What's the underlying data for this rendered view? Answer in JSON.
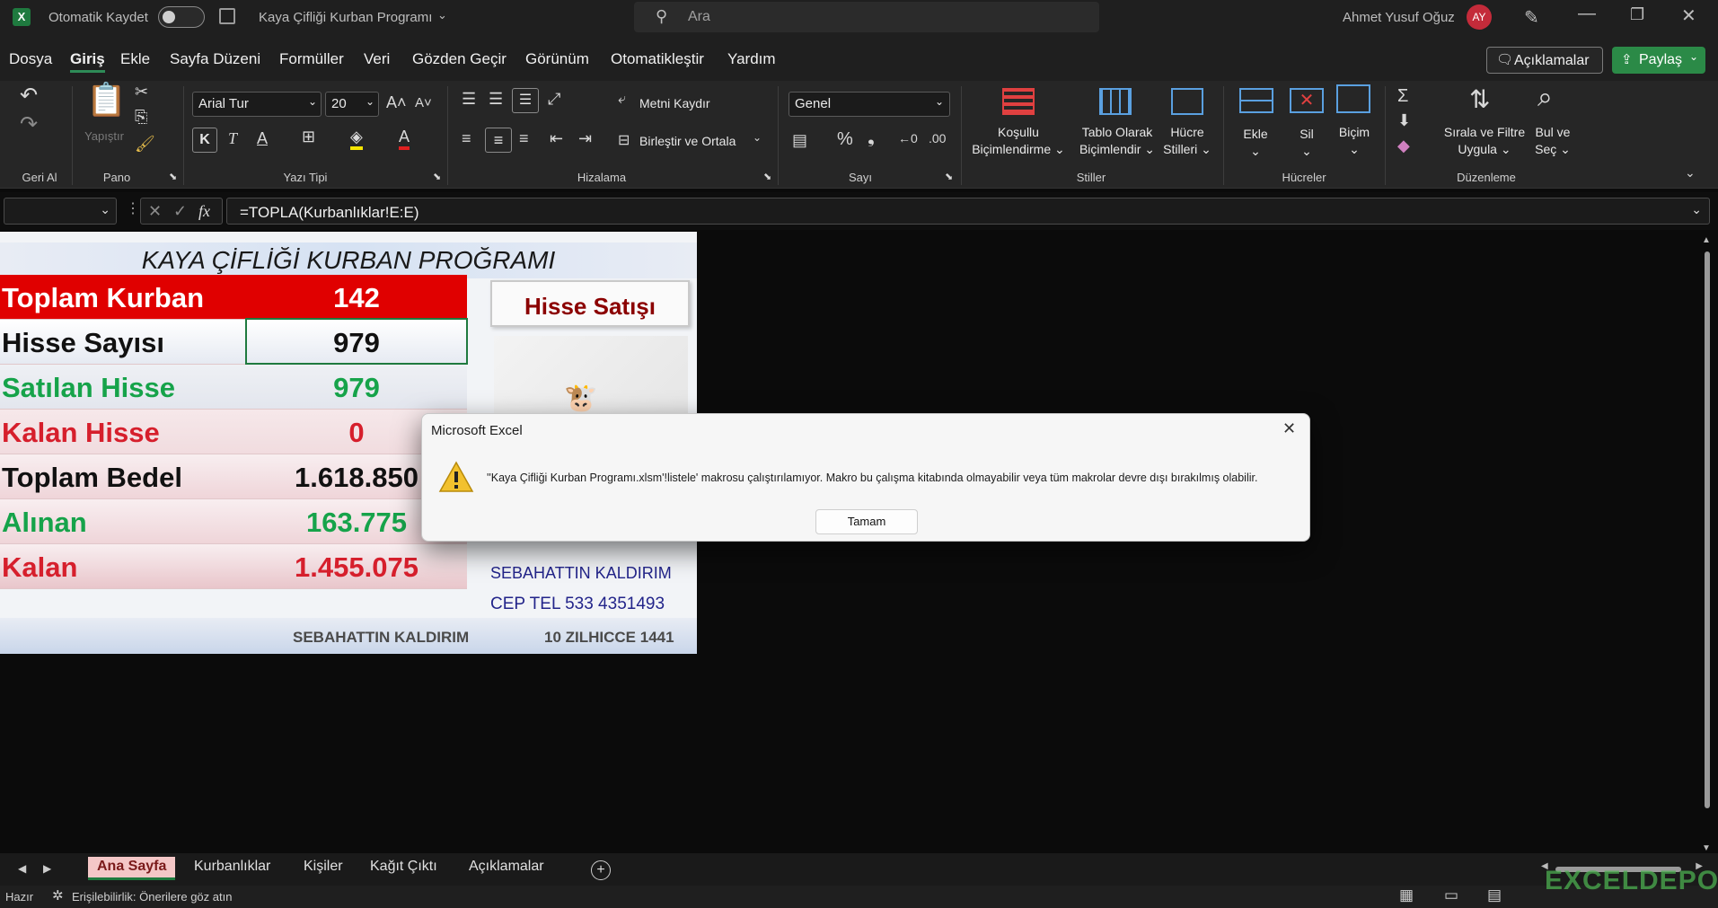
{
  "titlebar": {
    "autosave_label": "Otomatik Kaydet",
    "doc_title": "Kaya Çifliği Kurban Programı",
    "search_placeholder": "Ara",
    "user_name": "Ahmet Yusuf Oğuz",
    "user_initials": "AY"
  },
  "menu": [
    "Dosya",
    "Giriş",
    "Ekle",
    "Sayfa Düzeni",
    "Formüller",
    "Veri",
    "Gözden Geçir",
    "Görünüm",
    "Otomatikleştir",
    "Yardım"
  ],
  "menu_active": "Giriş",
  "actions": {
    "comments": "Açıklamalar",
    "share": "Paylaş"
  },
  "ribbon": {
    "groups": {
      "undo": "Geri Al",
      "clipboard": "Pano",
      "font": "Yazı Tipi",
      "alignment": "Hizalama",
      "number": "Sayı",
      "styles": "Stiller",
      "cells": "Hücreler",
      "editing": "Düzenleme"
    },
    "paste": "Yapıştır",
    "font_name": "Arial Tur",
    "font_size": "20",
    "bold": "K",
    "italic": "T",
    "underline": "A",
    "wrap_text": "Metni Kaydır",
    "merge_center": "Birleştir ve Ortala",
    "number_format": "Genel",
    "percent": "%",
    "conditional_1": "Koşullu",
    "conditional_2": "Biçimlendirme",
    "table_1": "Tablo Olarak",
    "table_2": "Biçimlendir",
    "cell_styles_1": "Hücre",
    "cell_styles_2": "Stilleri",
    "insert": "Ekle",
    "delete": "Sil",
    "format": "Biçim",
    "sort_1": "Sırala ve Filtre",
    "sort_2": "Uygula",
    "find_1": "Bul ve",
    "find_2": "Seç",
    "sigma": "Σ"
  },
  "formula": {
    "fx": "fx",
    "value": "=TOPLA(Kurbanlıklar!E:E)"
  },
  "sheet": {
    "title": "KAYA ÇİFLİĞİ KURBAN PROĞRAMI",
    "rows": [
      {
        "label": "Toplam Kurban",
        "value": "142"
      },
      {
        "label": "Hisse Sayısı",
        "value": "979"
      },
      {
        "label": "Satılan Hisse",
        "value": "979"
      },
      {
        "label": "Kalan Hisse",
        "value": "0"
      },
      {
        "label": "Toplam Bedel",
        "value": "1.618.850"
      },
      {
        "label": "Alınan",
        "value": "163.775"
      },
      {
        "label": "Kalan",
        "value": "1.455.075"
      }
    ],
    "hisse_button": "Hisse Satışı",
    "contact_name": "SEBAHATTIN KALDIRIM",
    "contact_phone": "CEP TEL 533 4351493",
    "footer_name": "SEBAHATTIN KALDIRIM",
    "footer_date": "10 ZILHICCE 1441"
  },
  "dialog": {
    "title": "Microsoft Excel",
    "message": "''Kaya Çifliği Kurban Programı.xlsm'!listele' makrosu çalıştırılamıyor. Makro bu çalışma kitabında olmayabilir veya tüm makrolar devre dışı bırakılmış olabilir.",
    "ok": "Tamam"
  },
  "tabs": [
    "Ana Sayfa",
    "Kurbanlıklar",
    "Kişiler",
    "Kağıt Çıktı",
    "Açıklamalar"
  ],
  "status": {
    "ready": "Hazır",
    "accessibility": "Erişilebilirlik: Önerilere göz atın"
  },
  "watermark": "EXCELDEPO",
  "colors": {
    "red_band": "#e00000",
    "green_text": "#16a34a",
    "red_text": "#d61f2c",
    "blue_text": "#22248a",
    "dark_red": "#8b0000",
    "excel_green": "#1f7a3f",
    "share_green": "#2b8a47"
  }
}
